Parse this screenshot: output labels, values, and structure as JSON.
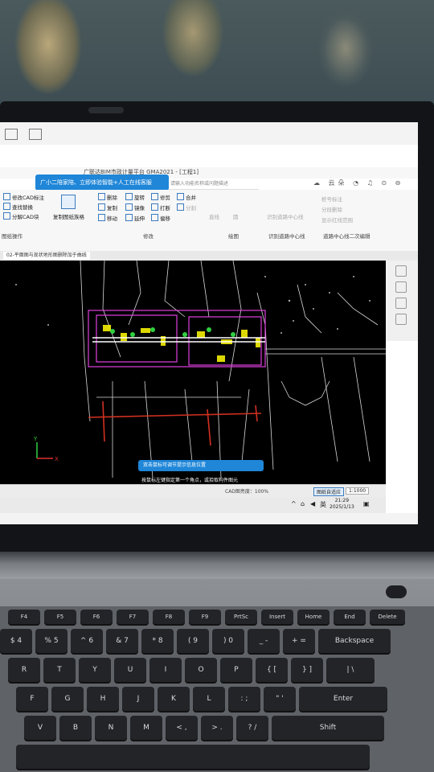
{
  "app": {
    "title": "广联达BIM市政计量平台 GMA2021 - [工程1]",
    "banner": "广小二陪家陪、立即体验智能+人工在线客服",
    "search_placeholder": "请输入功能名称或问题描述",
    "top_right_label": "云朵"
  },
  "ribbon": {
    "left_items": [
      {
        "label": "修改CAD标注"
      },
      {
        "label": "查找替换"
      },
      {
        "label": "分解CAD块"
      }
    ],
    "left_group": "图纸操作",
    "copy_tool": "复制图纸族格",
    "modify_items": [
      "删除",
      "旋转",
      "修剪",
      "合并",
      "复制",
      "镜像",
      "打断",
      "分割",
      "移动",
      "延伸",
      "偏移"
    ],
    "modify_group": "修改",
    "draw_items": [
      "直线",
      "圆"
    ],
    "draw_group": "绘图",
    "road_center": "识别道路中心线",
    "road_group": "识别道路中心线",
    "right_items": [
      "桩号标注",
      "分段删除",
      "显示红线范围"
    ],
    "right_group": "道路中心线二次编辑"
  },
  "document_tab": "02-平面图与现状地形图删除加于曲线",
  "canvas": {
    "hint_pill": "双击鼠标可调节提示信息位置",
    "hint_text": "按鼠标左键指定第一个角点，或拾取构件图元"
  },
  "status": {
    "cad_brightness": "CAD图亮度：100%",
    "zoom_button": "图纸自适应",
    "scale": "1:1000"
  },
  "tray": {
    "ime": "英",
    "time": "21:29",
    "date": "2025/1/13"
  },
  "keyboard": {
    "fn_row": [
      "F4",
      "F5",
      "F6",
      "F7",
      "F8",
      "F9",
      "PrtSc",
      "Insert",
      "Home",
      "End",
      "Delete"
    ],
    "num_row": [
      "$ 4",
      "% 5",
      "^ 6",
      "& 7",
      "* 8",
      "( 9",
      ") 0",
      "_ -",
      "+ =",
      "Backspace"
    ],
    "top_row": [
      "R",
      "T",
      "Y",
      "U",
      "I",
      "O",
      "P",
      "{ [",
      "} ]",
      "| \\"
    ],
    "home_row": [
      "F",
      "G",
      "H",
      "J",
      "K",
      "L",
      ": ;",
      "\" '",
      "Enter"
    ],
    "bottom_row": [
      "V",
      "B",
      "N",
      "M",
      "< ,",
      "> .",
      "? /",
      "Shift"
    ]
  },
  "colors": {
    "accent": "#1f86d8",
    "canvas_bg": "#000000",
    "highlight_magenta": "#e040e0",
    "highlight_yellow": "#f5f000",
    "road_red": "#d03020"
  }
}
